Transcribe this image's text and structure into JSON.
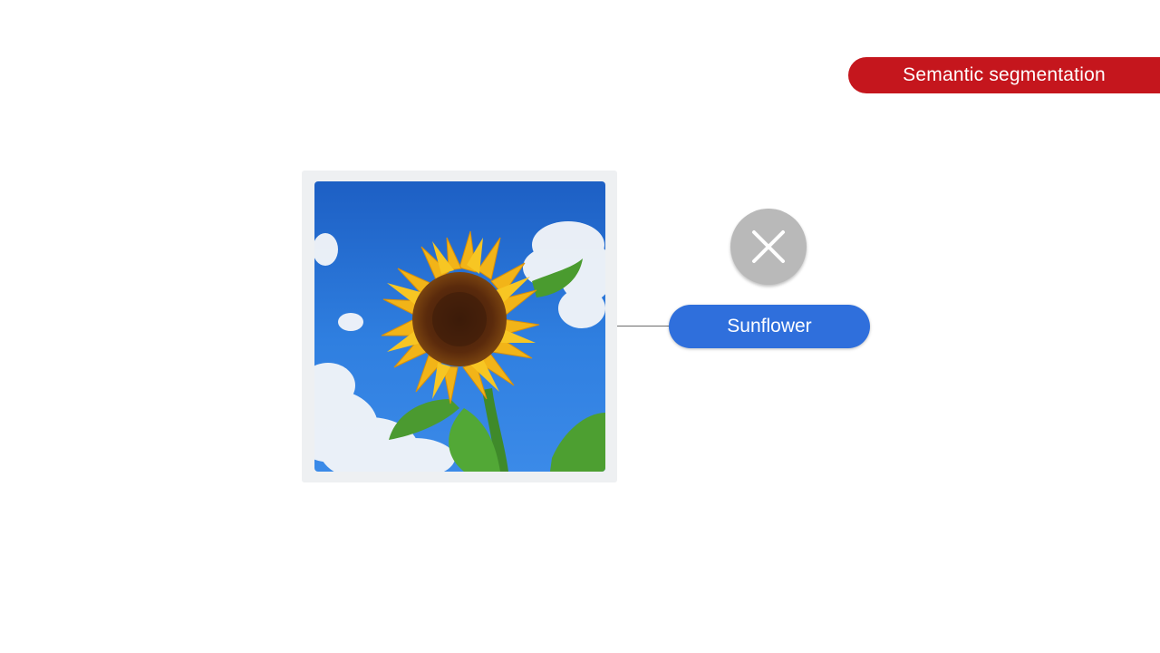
{
  "slide": {
    "topic_tag": "Semantic segmentation",
    "label": "Sunflower",
    "badge_icon": "close-icon",
    "colors": {
      "tag": "#c5161d",
      "label": "#2f6fdc",
      "badge": "#b9b9b9"
    }
  }
}
